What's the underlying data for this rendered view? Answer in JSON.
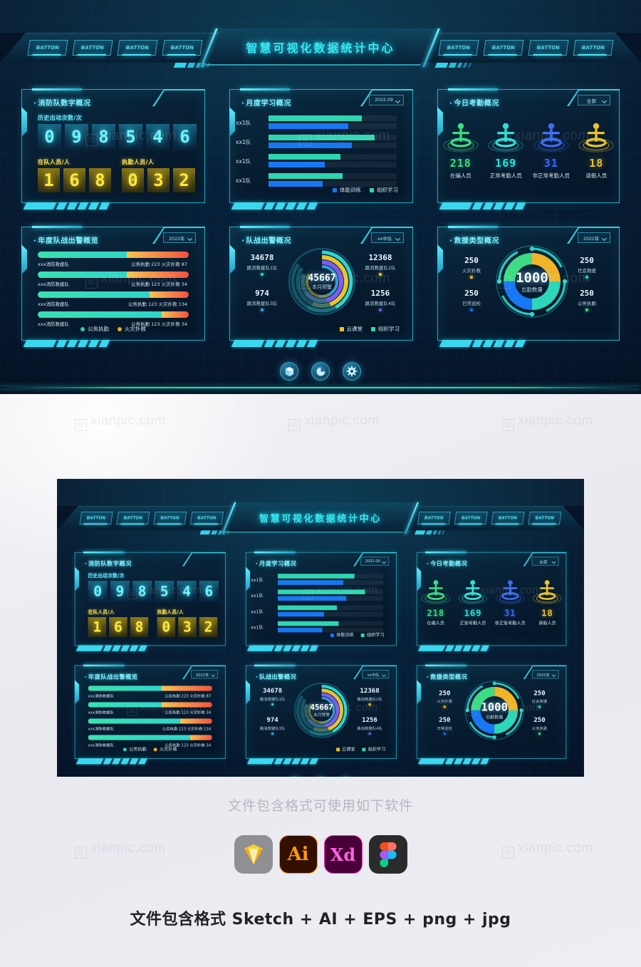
{
  "header": {
    "title": "智慧可视化数据统计中心",
    "left_buttons": [
      "BATTON",
      "BATTON",
      "BATTON",
      "BATTON"
    ],
    "right_buttons": [
      "BATTON",
      "BATTON",
      "BATTON",
      "BATTON"
    ]
  },
  "panel1": {
    "title": "消防队数字概况",
    "history_label": "历史出动次数/次",
    "history_digits": [
      "0",
      "9",
      "8",
      "5",
      "4",
      "6"
    ],
    "onteam_label": "在队人员/人",
    "onteam_digits": [
      "1",
      "6",
      "8"
    ],
    "onduty_label": "执勤人员/人",
    "onduty_digits": [
      "0",
      "3",
      "2"
    ]
  },
  "panel2": {
    "title": "月度学习概况",
    "filter": "2022.09",
    "legend": [
      {
        "label": "体能训练",
        "color": "#1877f2"
      },
      {
        "label": "组织学习",
        "color": "#2ed6b0"
      }
    ],
    "chart_data": {
      "type": "bar",
      "title": "月度学习概况",
      "orientation": "horizontal",
      "categories": [
        "xx1队",
        "xx1队",
        "xx1队",
        "xx1队"
      ],
      "series": [
        {
          "name": "组织学习",
          "color": "#2ed6b0",
          "values": [
            73,
            83,
            56,
            58
          ]
        },
        {
          "name": "体能训练",
          "color": "#1877f2",
          "values": [
            62,
            65,
            44,
            42
          ]
        }
      ],
      "xlim": [
        0,
        100
      ],
      "grid": false,
      "legend_position": "bottom-right"
    }
  },
  "panel3": {
    "title": "今日考勤概况",
    "filter": "全部",
    "chart_data": {
      "type": "bar",
      "title": "今日考勤概况",
      "categories": [
        "在编人员",
        "正常考勤人员",
        "非正常考勤人员",
        "请假人员"
      ],
      "values": [
        218,
        169,
        31,
        18
      ],
      "colors": [
        "#3ddc84",
        "#2ee0d8",
        "#3d6cf5",
        "#e8c42e"
      ]
    },
    "items": [
      {
        "value": "218",
        "caption": "在编人员",
        "color": "#3ddc84"
      },
      {
        "value": "169",
        "caption": "正常考勤人员",
        "color": "#2ee0d8"
      },
      {
        "value": "31",
        "caption": "非正常考勤人员",
        "color": "#3d6cf5"
      },
      {
        "value": "18",
        "caption": "请假人员",
        "color": "#e8c42e"
      }
    ]
  },
  "panel4": {
    "title": "年度队战出警概览",
    "filter": "2022年",
    "legend": [
      {
        "label": "公务执勤",
        "color": "#2ed6a8"
      },
      {
        "label": "火灾扑救",
        "color": "#f5a623"
      }
    ],
    "chart_data": {
      "type": "bar",
      "title": "年度队战出警概览",
      "orientation": "horizontal-stacked",
      "categories": [
        "xxx消防救援队",
        "xxx消防救援队",
        "xxx消防救援队",
        "xxx消防救援队"
      ],
      "series": [
        {
          "name": "公务执勤",
          "color": "#2ed6a8",
          "values": [
            223,
            123,
            123,
            123
          ]
        },
        {
          "name": "火灾扑救",
          "color": "#f5a623",
          "values": [
            87,
            34,
            134,
            34
          ]
        }
      ]
    },
    "rows": [
      {
        "name": "xxx消防救援队",
        "duty_label": "公务执勤",
        "duty": "223",
        "fire_label": "火灾扑救",
        "fire": "87",
        "duty_pct": 59,
        "fire_pct": 41
      },
      {
        "name": "xxx消防救援队",
        "duty_label": "公务执勤",
        "duty": "123",
        "fire_label": "火灾扑救",
        "fire": "34",
        "duty_pct": 59,
        "fire_pct": 41
      },
      {
        "name": "xxx消防救援队",
        "duty_label": "公务执勤",
        "duty": "123",
        "fire_label": "火灾扑救",
        "fire": "134",
        "duty_pct": 74,
        "fire_pct": 26
      },
      {
        "name": "xxx消防救援队",
        "duty_label": "公务执勤",
        "duty": "123",
        "fire_label": "火灾扑救",
        "fire": "34",
        "duty_pct": 82,
        "fire_pct": 18
      }
    ]
  },
  "panel5": {
    "title": "队战出警概况",
    "filter": "xx中队",
    "center_value": "45667",
    "center_label": "本月预警",
    "legend": [
      {
        "label": "云课堂",
        "color": "#e8c42e"
      },
      {
        "label": "组织学习",
        "color": "#2ed6b0"
      }
    ],
    "chart_data": {
      "type": "pie",
      "title": "队战出警概况",
      "subtype": "multi-ring-donut",
      "center_value": 45667,
      "center_label": "本月预警",
      "labels": [
        "路消救援队1队",
        "路消救援队2队",
        "路消救援队3队",
        "路消救援队4队"
      ],
      "values": [
        34678,
        12368,
        974,
        1256
      ],
      "colors": [
        "#2ed6d0",
        "#e8c42e",
        "#3da9e8",
        "#7b5cf0"
      ]
    },
    "kpis": [
      {
        "value": "34678",
        "caption": "路消救援队1队",
        "color": "#2ed6d0"
      },
      {
        "value": "12368",
        "caption": "路消救援队2队",
        "color": "#e8c42e"
      },
      {
        "value": "974",
        "caption": "路消救援队3队",
        "color": "#3da9e8"
      },
      {
        "value": "1256",
        "caption": "路消救援队4队",
        "color": "#7b5cf0"
      }
    ]
  },
  "panel6": {
    "title": "救援类型概况",
    "filter": "2022年",
    "center_value": "1000",
    "center_label": "出勤数量",
    "chart_data": {
      "type": "pie",
      "title": "救援类型概况",
      "subtype": "donut",
      "center_value": 1000,
      "center_label": "出勤数量",
      "labels": [
        "火灾扑救",
        "社会救援",
        "日常巡检",
        "公务执勤"
      ],
      "values": [
        250,
        250,
        250,
        250
      ],
      "colors": [
        "#f0b429",
        "#2ed6b8",
        "#1877f2",
        "#3ddc84"
      ]
    },
    "kpis": [
      {
        "value": "250",
        "caption": "火灾扑救",
        "color": "#f0b429"
      },
      {
        "value": "250",
        "caption": "社会救援",
        "color": "#2ed6b8"
      },
      {
        "value": "250",
        "caption": "日常巡检",
        "color": "#1877f2"
      },
      {
        "value": "250",
        "caption": "公务执勤",
        "color": "#3ddc84"
      }
    ]
  },
  "footer_buttons": [
    {
      "icon": "cube-icon"
    },
    {
      "icon": "pie-chart-icon"
    },
    {
      "icon": "gear-icon"
    }
  ],
  "formats": {
    "heading": "文件包含格式可使用如下软件",
    "apps": [
      "Sketch",
      "Ai",
      "Xd",
      "Figma"
    ],
    "footer": "文件包含格式 Sketch + AI + EPS + png + jpg"
  },
  "watermark": "xianpic.com"
}
